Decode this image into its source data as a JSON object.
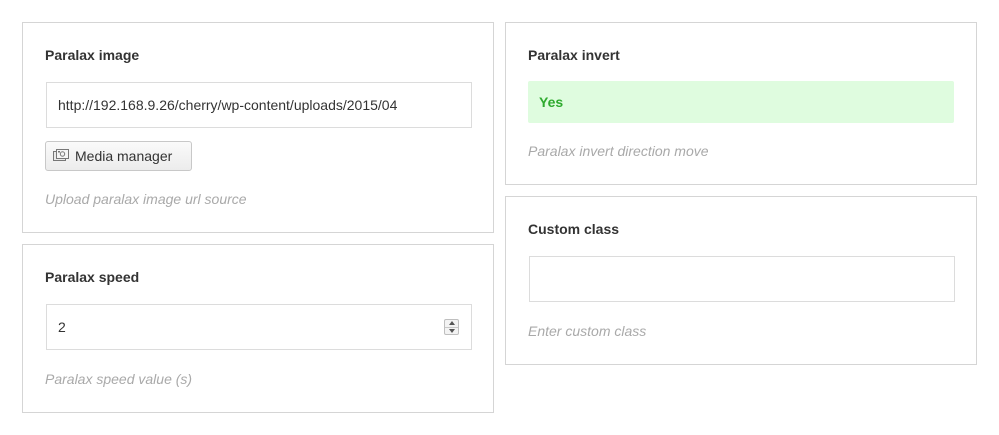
{
  "paralax_image": {
    "title": "Paralax image",
    "url_value": "http://192.168.9.26/cherry/wp-content/uploads/2015/04",
    "media_button_label": "Media manager",
    "media_button_icon": "media-manager-icon",
    "description": "Upload paralax image url source"
  },
  "paralax_speed": {
    "title": "Paralax speed",
    "value": "2",
    "spinner_icon": "number-spinner-icon",
    "description": "Paralax speed value (s)"
  },
  "paralax_invert": {
    "title": "Paralax invert",
    "toggle_label": "Yes",
    "toggle_color": "#2eaa2e",
    "toggle_background": "#dffcdf",
    "description": "Paralax invert direction move"
  },
  "custom_class": {
    "title": "Custom class",
    "value": "",
    "description": "Enter custom class"
  }
}
